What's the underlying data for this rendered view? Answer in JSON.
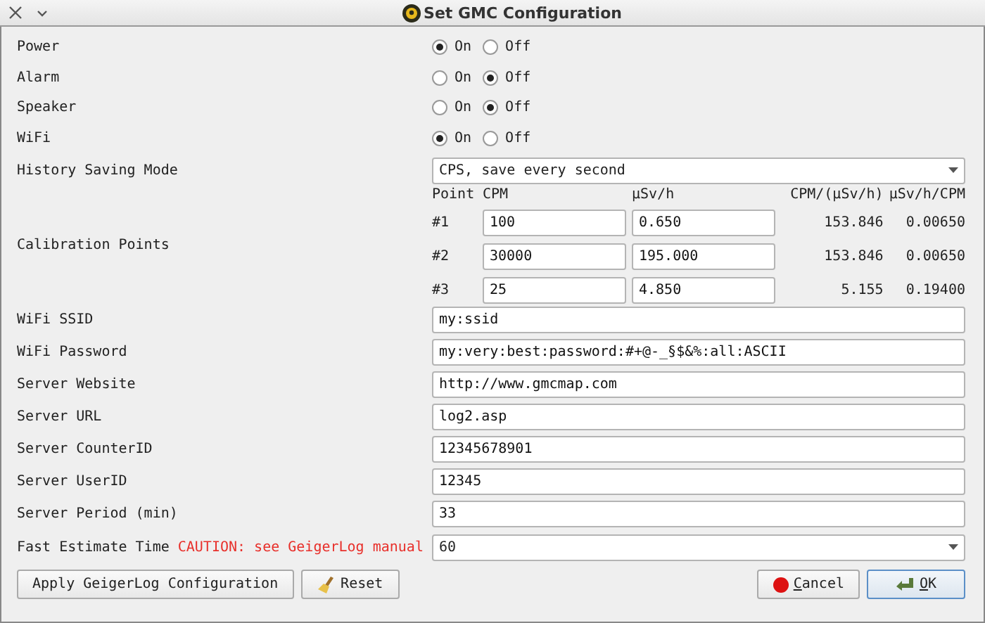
{
  "window": {
    "title": "Set GMC Configuration"
  },
  "toggles": [
    {
      "label": "Power",
      "options": [
        {
          "label": "On",
          "selected": true
        },
        {
          "label": "Off",
          "selected": false
        }
      ]
    },
    {
      "label": "Alarm",
      "options": [
        {
          "label": "On",
          "selected": false
        },
        {
          "label": "Off",
          "selected": true
        }
      ]
    },
    {
      "label": "Speaker",
      "options": [
        {
          "label": "On",
          "selected": false
        },
        {
          "label": "Off",
          "selected": true
        }
      ]
    },
    {
      "label": "WiFi",
      "options": [
        {
          "label": "On",
          "selected": true
        },
        {
          "label": "Off",
          "selected": false
        }
      ]
    }
  ],
  "history_saving_mode": {
    "label": "History Saving Mode",
    "value": "CPS, save every second"
  },
  "calibration": {
    "label": "Calibration Points",
    "headers": [
      "Point",
      "CPM",
      "µSv/h",
      "CPM/(µSv/h)",
      "µSv/h/CPM"
    ],
    "points": [
      {
        "point": "#1",
        "cpm": "100",
        "usvh": "0.650",
        "ratio": "153.846",
        "inverse": "0.00650"
      },
      {
        "point": "#2",
        "cpm": "30000",
        "usvh": "195.000",
        "ratio": "153.846",
        "inverse": "0.00650"
      },
      {
        "point": "#3",
        "cpm": "25",
        "usvh": "4.850",
        "ratio": "5.155",
        "inverse": "0.19400"
      }
    ]
  },
  "fields": [
    {
      "label": "WiFi SSID",
      "value": "my:ssid"
    },
    {
      "label": "WiFi Password",
      "value": "my:very:best:password:#+@-_§$&%:all:ASCII"
    },
    {
      "label": "Server Website",
      "value": "http://www.gmcmap.com"
    },
    {
      "label": "Server URL",
      "value": "log2.asp"
    },
    {
      "label": "Server CounterID",
      "value": "12345678901"
    },
    {
      "label": "Server UserID",
      "value": "12345"
    },
    {
      "label": "Server Period (min)",
      "value": "33"
    }
  ],
  "fast_estimate": {
    "label": "Fast Estimate Time",
    "caution": "CAUTION: see GeigerLog manual",
    "value": "60"
  },
  "buttons_left": [
    {
      "label": "Apply GeigerLog Configuration",
      "kind": "plain",
      "default": false
    },
    {
      "label": "Reset",
      "kind": "broom",
      "default": false
    }
  ],
  "buttons_right": [
    {
      "label": "Cancel",
      "kind": "stop",
      "default": false
    },
    {
      "label": "OK",
      "kind": "check",
      "default": true
    }
  ]
}
